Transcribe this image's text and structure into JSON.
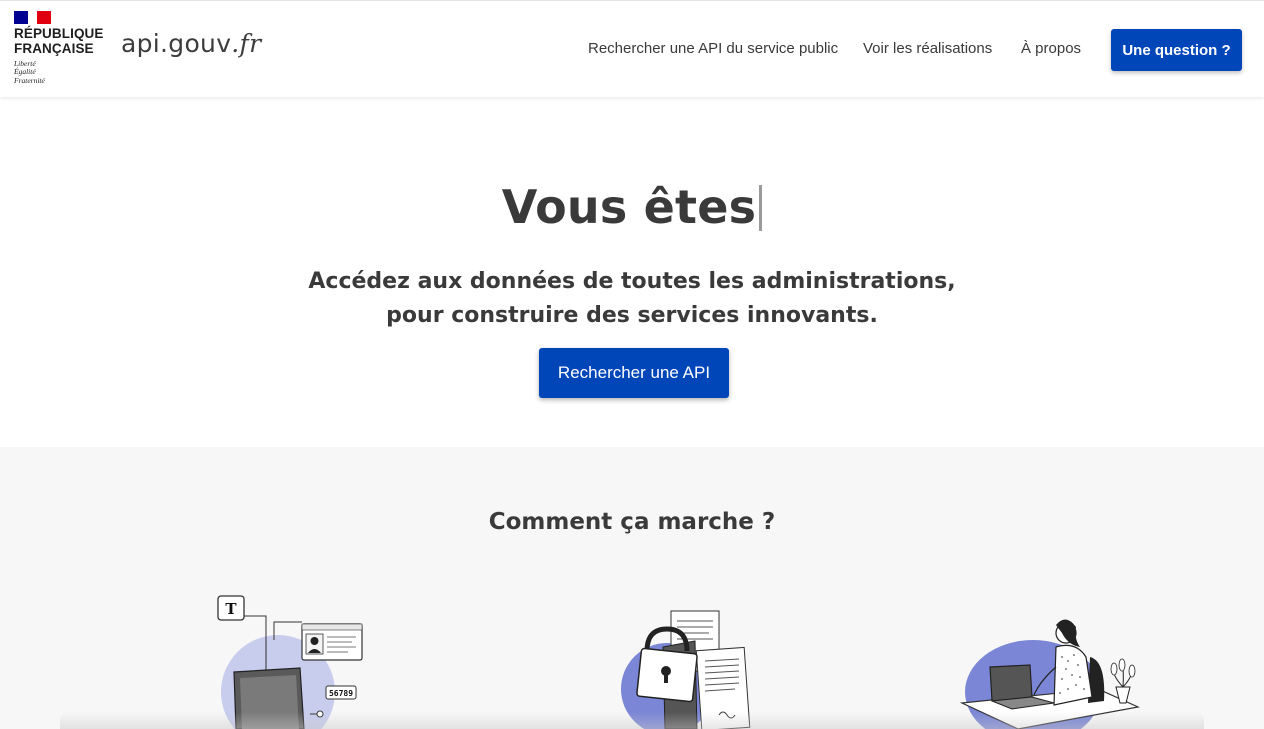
{
  "header": {
    "gov_logo": {
      "title_line1": "République",
      "title_line2": "Française",
      "motto_line1": "Liberté",
      "motto_line2": "Égalité",
      "motto_line3": "Fraternité"
    },
    "site_name": "api.gouv",
    "site_tld": ".fr",
    "nav": [
      {
        "label": "Rechercher une API du service public"
      },
      {
        "label": "Voir les réalisations"
      },
      {
        "label": "À propos"
      }
    ],
    "cta_label": "Une question ?"
  },
  "hero": {
    "title": "Vous êtes",
    "subtitle_line1": "Accédez aux données de toutes les administrations,",
    "subtitle_line2": "pour construire des services innovants.",
    "button_label": "Rechercher une API"
  },
  "how_it_works": {
    "title": "Comment ça marche ?",
    "illustrations": [
      {
        "icon": "data-sources-illustration",
        "labels": [
          "T",
          "56789"
        ]
      },
      {
        "icon": "secure-documents-illustration"
      },
      {
        "icon": "developer-at-laptop-illustration"
      }
    ]
  },
  "colors": {
    "primary": "#0046b8",
    "text": "#3a3a3a",
    "section_background": "#f7f7f7",
    "illustration_accent": "#7b86d6",
    "flag_blue": "#000091",
    "flag_red": "#e1000f"
  }
}
